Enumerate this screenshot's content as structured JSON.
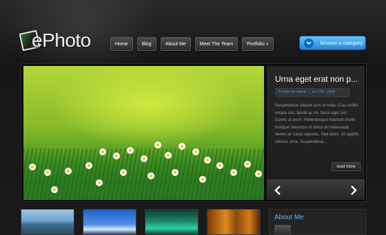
{
  "brand": {
    "name": "ePhoto"
  },
  "nav": {
    "items": [
      {
        "label": "Home"
      },
      {
        "label": "Blog"
      },
      {
        "label": "About Me"
      },
      {
        "label": "Meet The Team"
      },
      {
        "label": "Portfolio »"
      }
    ]
  },
  "browse": {
    "label": "browse a category"
  },
  "featured": {
    "title": "Urna eget erat non p...",
    "author_prefix": "Posted by",
    "author": "admin",
    "separator": "|",
    "date": "Jul 17th, 2008",
    "excerpt": "Suspendisse aliquet sem ut nulla. Cras mollis ornare nisl. Morbi ac mi. Nunc eget nisl. Donec at enim. Pellentesque habitant morbi tristique senectus et netus et malesuada fames ac turpis egestas. Sed diam. Ut sagittis ultrices urna. Suspendisse...",
    "read_more": "read more"
  },
  "sidebar": {
    "heading": "About Me"
  },
  "colors": {
    "accent": "#3fa2ea",
    "button_blue": "#1d88d8",
    "background": "#1b1b1b"
  },
  "icons": {
    "browse": "chevron-down-icon",
    "prev": "arrow-left-icon",
    "next": "arrow-right-icon"
  }
}
